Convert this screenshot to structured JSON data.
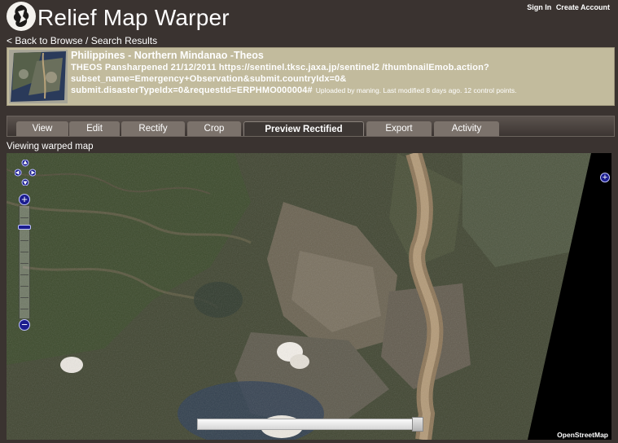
{
  "header": {
    "app_title": "Relief Map Warper",
    "sign_in": "Sign In",
    "create_account": "Create Account",
    "back_link": "< Back to Browse / Search Results"
  },
  "map_info": {
    "title": "Philippines - Northern Mindanao -Theos",
    "description": "THEOS Pansharpened 21/12/2011 https://sentinel.tksc.jaxa.jp/sentinel2 /thumbnailEmob.action?subset_name=Emergency+Observation&submit.countryIdx=0& submit.disasterTypeIdx=0&requestId=ERPHMO000004#",
    "meta": "Uploaded by maning. Last modified 8 days ago. 12 control points."
  },
  "tabs": [
    "View",
    "Edit",
    "Rectify",
    "Crop",
    "Preview Rectified",
    "Export",
    "Activity"
  ],
  "active_tab": "Preview Rectified",
  "viewing_label": "Viewing warped map",
  "map": {
    "attribution": "OpenStreetMap",
    "zoom_in": "+",
    "zoom_out": "−",
    "layer_switcher": "+",
    "opacity": 0.95
  },
  "colors": {
    "background": "#3a3330",
    "info_box": "#c2bb9d",
    "tab": "#7b726b",
    "active_tab": "#3d3734",
    "control_blue": "#1b1d8e"
  },
  "icons": [
    "logo-icon",
    "pan-arrows-icon",
    "zoom-in-icon",
    "zoom-out-icon",
    "layer-switcher-icon"
  ]
}
